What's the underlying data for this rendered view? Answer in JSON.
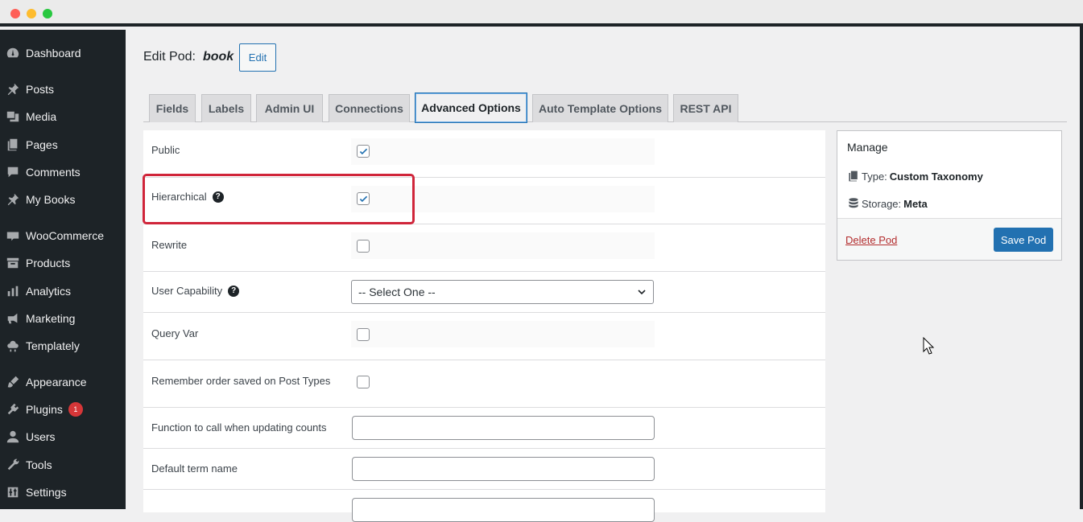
{
  "window": {
    "controls": [
      "close",
      "minimize",
      "zoom"
    ]
  },
  "sidebar": {
    "items": [
      {
        "label": "Dashboard",
        "icon": "dashboard-icon"
      },
      {
        "label": "Posts",
        "icon": "pin-icon"
      },
      {
        "label": "Media",
        "icon": "media-icon"
      },
      {
        "label": "Pages",
        "icon": "pages-icon"
      },
      {
        "label": "Comments",
        "icon": "comment-icon"
      },
      {
        "label": "My Books",
        "icon": "pin-icon"
      },
      {
        "label": "WooCommerce",
        "icon": "woo-icon"
      },
      {
        "label": "Products",
        "icon": "archive-icon"
      },
      {
        "label": "Analytics",
        "icon": "bar-chart-icon"
      },
      {
        "label": "Marketing",
        "icon": "megaphone-icon"
      },
      {
        "label": "Templately",
        "icon": "templately-icon"
      },
      {
        "label": "Appearance",
        "icon": "brush-icon"
      },
      {
        "label": "Plugins",
        "icon": "plugin-icon",
        "badge": "1"
      },
      {
        "label": "Users",
        "icon": "user-icon"
      },
      {
        "label": "Tools",
        "icon": "wrench-icon"
      },
      {
        "label": "Settings",
        "icon": "settings-icon"
      }
    ]
  },
  "header": {
    "title": "Edit Pod:",
    "pod_name": "book",
    "edit_label": "Edit"
  },
  "tabs": [
    {
      "label": "Fields"
    },
    {
      "label": "Labels"
    },
    {
      "label": "Admin UI"
    },
    {
      "label": "Connections"
    },
    {
      "label": "Advanced Options",
      "active": true
    },
    {
      "label": "Auto Template Options"
    },
    {
      "label": "REST API"
    }
  ],
  "form": {
    "public": {
      "label": "Public",
      "checked": true
    },
    "hierarchical": {
      "label": "Hierarchical",
      "checked": true
    },
    "rewrite": {
      "label": "Rewrite",
      "checked": false
    },
    "user_capability": {
      "label": "User Capability",
      "value": "-- Select One --"
    },
    "query_var": {
      "label": "Query Var",
      "checked": false
    },
    "remember_order": {
      "label": "Remember order saved on Post Types",
      "checked": false
    },
    "update_count_fn": {
      "label": "Function to call when updating counts",
      "value": ""
    },
    "default_term": {
      "label": "Default term name",
      "value": ""
    }
  },
  "manage": {
    "title": "Manage",
    "type_label": "Type:",
    "type_value": "Custom Taxonomy",
    "storage_label": "Storage:",
    "storage_value": "Meta",
    "delete_label": "Delete Pod",
    "save_label": "Save Pod"
  },
  "colors": {
    "accent": "#2271b1",
    "highlight": "#d0253a",
    "sidebar": "#1d2327"
  }
}
